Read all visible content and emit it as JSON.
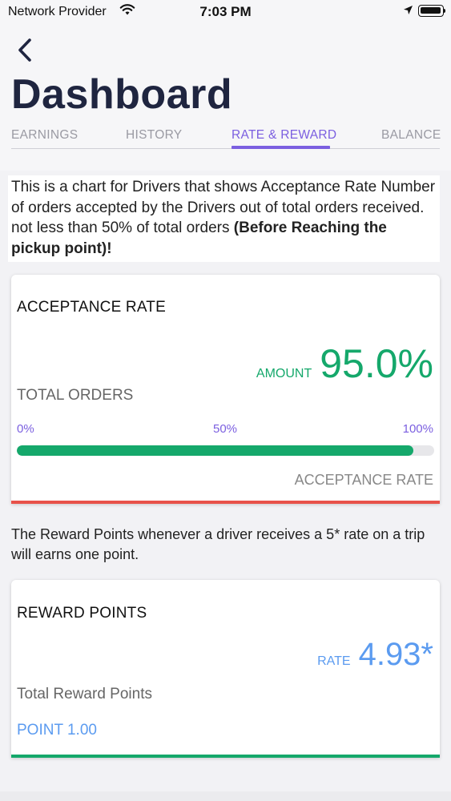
{
  "status_bar": {
    "carrier": "Network Provider",
    "time": "7:03 PM"
  },
  "header": {
    "title": "Dashboard"
  },
  "tabs": [
    {
      "label": "EARNINGS",
      "active": false
    },
    {
      "label": "HISTORY",
      "active": false
    },
    {
      "label": "RATE & REWARD",
      "active": true
    },
    {
      "label": "BALANCE",
      "active": false
    }
  ],
  "description": {
    "text": "This is a chart for Drivers that shows Acceptance Rate Number of orders accepted by the Drivers out of total orders received. not less than 50% of total orders ",
    "bold": "(Before Reaching the pickup point)!"
  },
  "acceptance_card": {
    "title": "ACCEPTANCE RATE",
    "amount_label": "AMOUNT",
    "amount_value": "95.0%",
    "total_orders_label": "TOTAL ORDERS",
    "scale": [
      "0%",
      "50%",
      "100%"
    ],
    "progress_fraction": 0.95,
    "caption": "ACCEPTANCE RATE"
  },
  "reward_note": "The Reward Points whenever a driver receives a 5* rate on a trip will earns one point.",
  "reward_card": {
    "title": "REWARD POINTS",
    "rate_label": "RATE",
    "rate_value": "4.93*",
    "total_label": "Total Reward Points",
    "point_value": "POINT 1.00"
  },
  "colors": {
    "accent_purple": "#7b5fe0",
    "green": "#15a86b",
    "red": "#e8524a",
    "blue": "#5b9bf0",
    "title_navy": "#1f2540"
  }
}
